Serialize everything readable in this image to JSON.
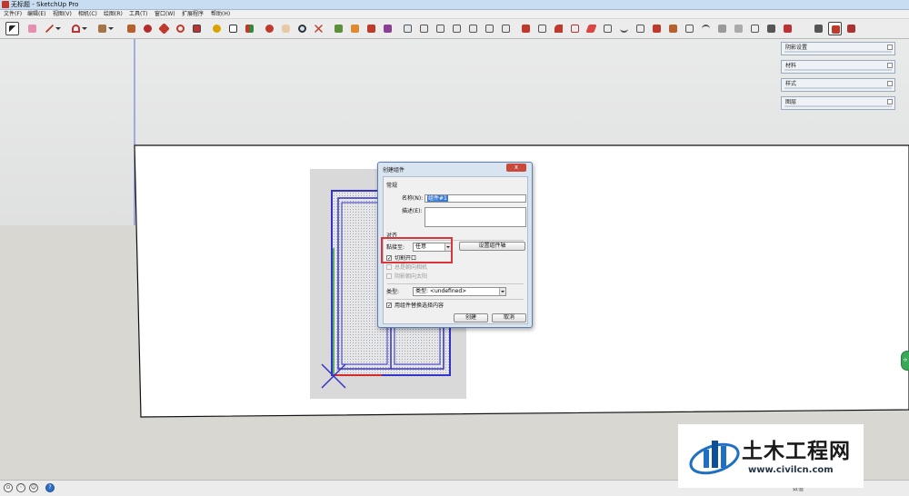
{
  "window": {
    "title": "无标题 - SketchUp Pro"
  },
  "menu": [
    "文件(F)",
    "编辑(E)",
    "视图(V)",
    "相机(C)",
    "绘图(R)",
    "工具(T)",
    "窗口(W)",
    "扩展程序",
    "帮助(H)"
  ],
  "trays": [
    {
      "label": "阴影设置"
    },
    {
      "label": "材料"
    },
    {
      "label": "样式"
    },
    {
      "label": "图层"
    }
  ],
  "dialog": {
    "title": "创建组件",
    "close_label": "x",
    "general_header": "常规",
    "name_label": "名称(N):",
    "name_value": "组件#1",
    "desc_label": "描述(E):",
    "desc_value": "",
    "align_header": "对齐",
    "glue_label": "黏接至:",
    "glue_value": "任意",
    "set_axes_button": "设置组件轴",
    "cut_opening_label": "切割开口",
    "always_face_label": "总是朝向相机",
    "shadows_face_label": "阴影朝向太阳",
    "type_label": "类型:",
    "type_value": "类型: <undefined>",
    "replace_label": "用组件替换选择内容",
    "create_button": "创建",
    "cancel_button": "取消"
  },
  "status": {
    "measure_label": "数值"
  },
  "watermark": {
    "brand": "土木工程网",
    "url": "www.civilcn.com"
  },
  "colors": {
    "axis_red": "#d62828",
    "axis_green": "#2e9e3a",
    "axis_blue": "#2d2dcf",
    "highlight": "#d8353d",
    "selection": "#3c7bd4"
  }
}
